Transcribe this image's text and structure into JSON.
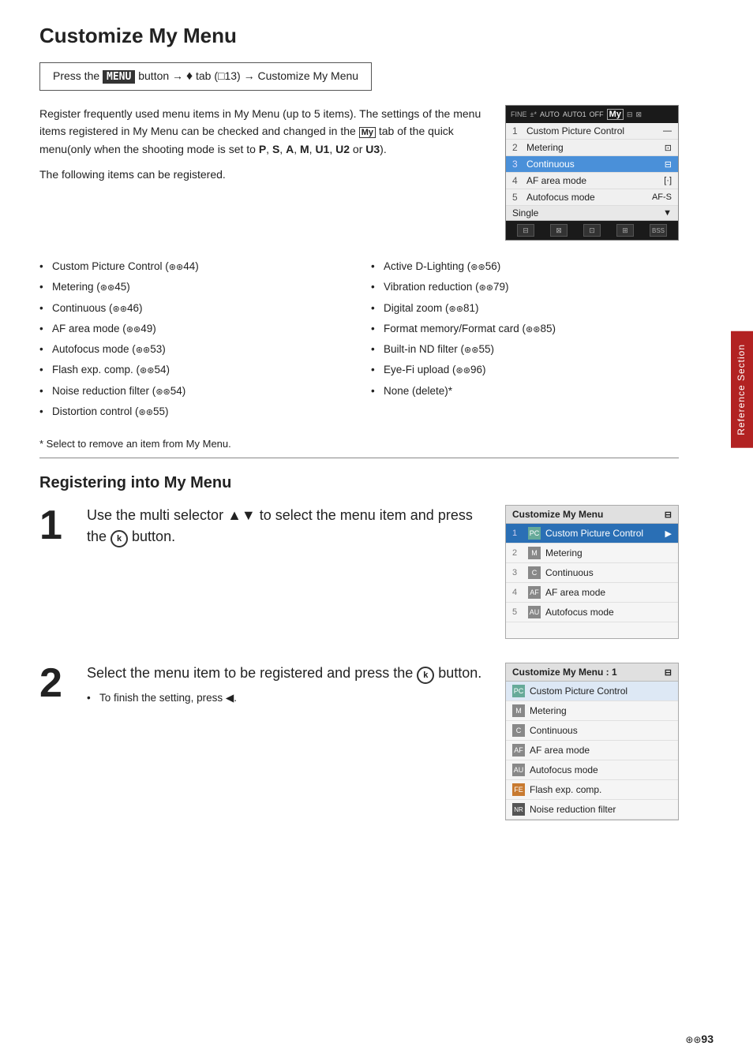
{
  "page": {
    "title": "Customize My Menu",
    "instruction": {
      "prefix": "Press the",
      "menu_key": "MENU",
      "middle": "button →",
      "tab": "⊻",
      "tab_ref": "(□13)",
      "suffix": "→ Customize My Menu"
    },
    "intro_paragraphs": [
      "Register frequently used menu items in My Menu (up to 5 items). The settings of the menu items registered in My Menu can be checked and changed in the",
      "tab of the quick menu(only when the shooting mode is set to P, S, A, M, U1, U2 or U3).",
      "The following items can be registered."
    ],
    "bullets_left": [
      "Custom Picture Control (⊛⊛44)",
      "Metering (⊛⊛45)",
      "Continuous (⊛⊛46)",
      "AF area mode (⊛⊛49)",
      "Autofocus mode (⊛⊛53)",
      "Flash exp. comp. (⊛⊛54)",
      "Noise reduction filter (⊛⊛54)",
      "Distortion control (⊛⊛55)"
    ],
    "bullets_right": [
      "Active D-Lighting (⊛⊛56)",
      "Vibration reduction (⊛⊛79)",
      "Digital zoom (⊛⊛81)",
      "Format memory/Format card (⊛⊛85)",
      "Built-in ND filter (⊛⊛55)",
      "Eye-Fi upload (⊛⊛96)",
      "None (delete)*"
    ],
    "footnote": "* Select to remove an item from My Menu.",
    "registering_title": "Registering into My Menu",
    "step1": {
      "number": "1",
      "text": "Use the multi selector ▲▼ to select the menu item and press the",
      "ok_label": "k",
      "text2": "button."
    },
    "step2": {
      "number": "2",
      "text": "Select the menu item to be registered and press the",
      "ok_label": "k",
      "text2": "button.",
      "sub": "To finish the setting, press ◀."
    },
    "camera_screen": {
      "top_items": [
        "FINE",
        "±*",
        "AUTO",
        "AUTO1",
        "OFF",
        "My",
        "⊡⊡"
      ],
      "menu_items": [
        {
          "num": "1",
          "label": "Custom Picture Control",
          "val": "—"
        },
        {
          "num": "2",
          "label": "Metering",
          "val": "⊡"
        },
        {
          "num": "3",
          "label": "Continuous",
          "val": "⊡",
          "highlighted": true
        },
        {
          "num": "4",
          "label": "AF area mode",
          "val": "[·]"
        },
        {
          "num": "5",
          "label": "Autofocus mode",
          "val": "AF-S"
        }
      ],
      "sub_label": "Single",
      "bottom_icons": [
        "⊡",
        "⊡",
        "⊡",
        "⊡",
        "BSS"
      ]
    },
    "step1_screen": {
      "title": "Customize My Menu",
      "items": [
        {
          "num": "1",
          "label": "Custom Picture Control",
          "selected": true,
          "arrow": "▶"
        },
        {
          "num": "2",
          "label": "Metering"
        },
        {
          "num": "3",
          "label": "Continuous"
        },
        {
          "num": "4",
          "label": "AF area mode"
        },
        {
          "num": "5",
          "label": "Autofocus mode"
        }
      ]
    },
    "step2_screen": {
      "title": "Customize My Menu : 1",
      "items": [
        {
          "label": "Custom Picture Control",
          "icon": "PC"
        },
        {
          "label": "Metering",
          "icon": "M"
        },
        {
          "label": "Continuous",
          "icon": "C"
        },
        {
          "label": "AF area mode",
          "icon": "AF"
        },
        {
          "label": "Autofocus mode",
          "icon": "AU"
        },
        {
          "label": "Flash exp. comp.",
          "icon": "FE"
        },
        {
          "label": "Noise reduction filter",
          "icon": "NR"
        }
      ]
    },
    "side_tab": "Reference Section",
    "page_number": "⊛⊛93"
  }
}
